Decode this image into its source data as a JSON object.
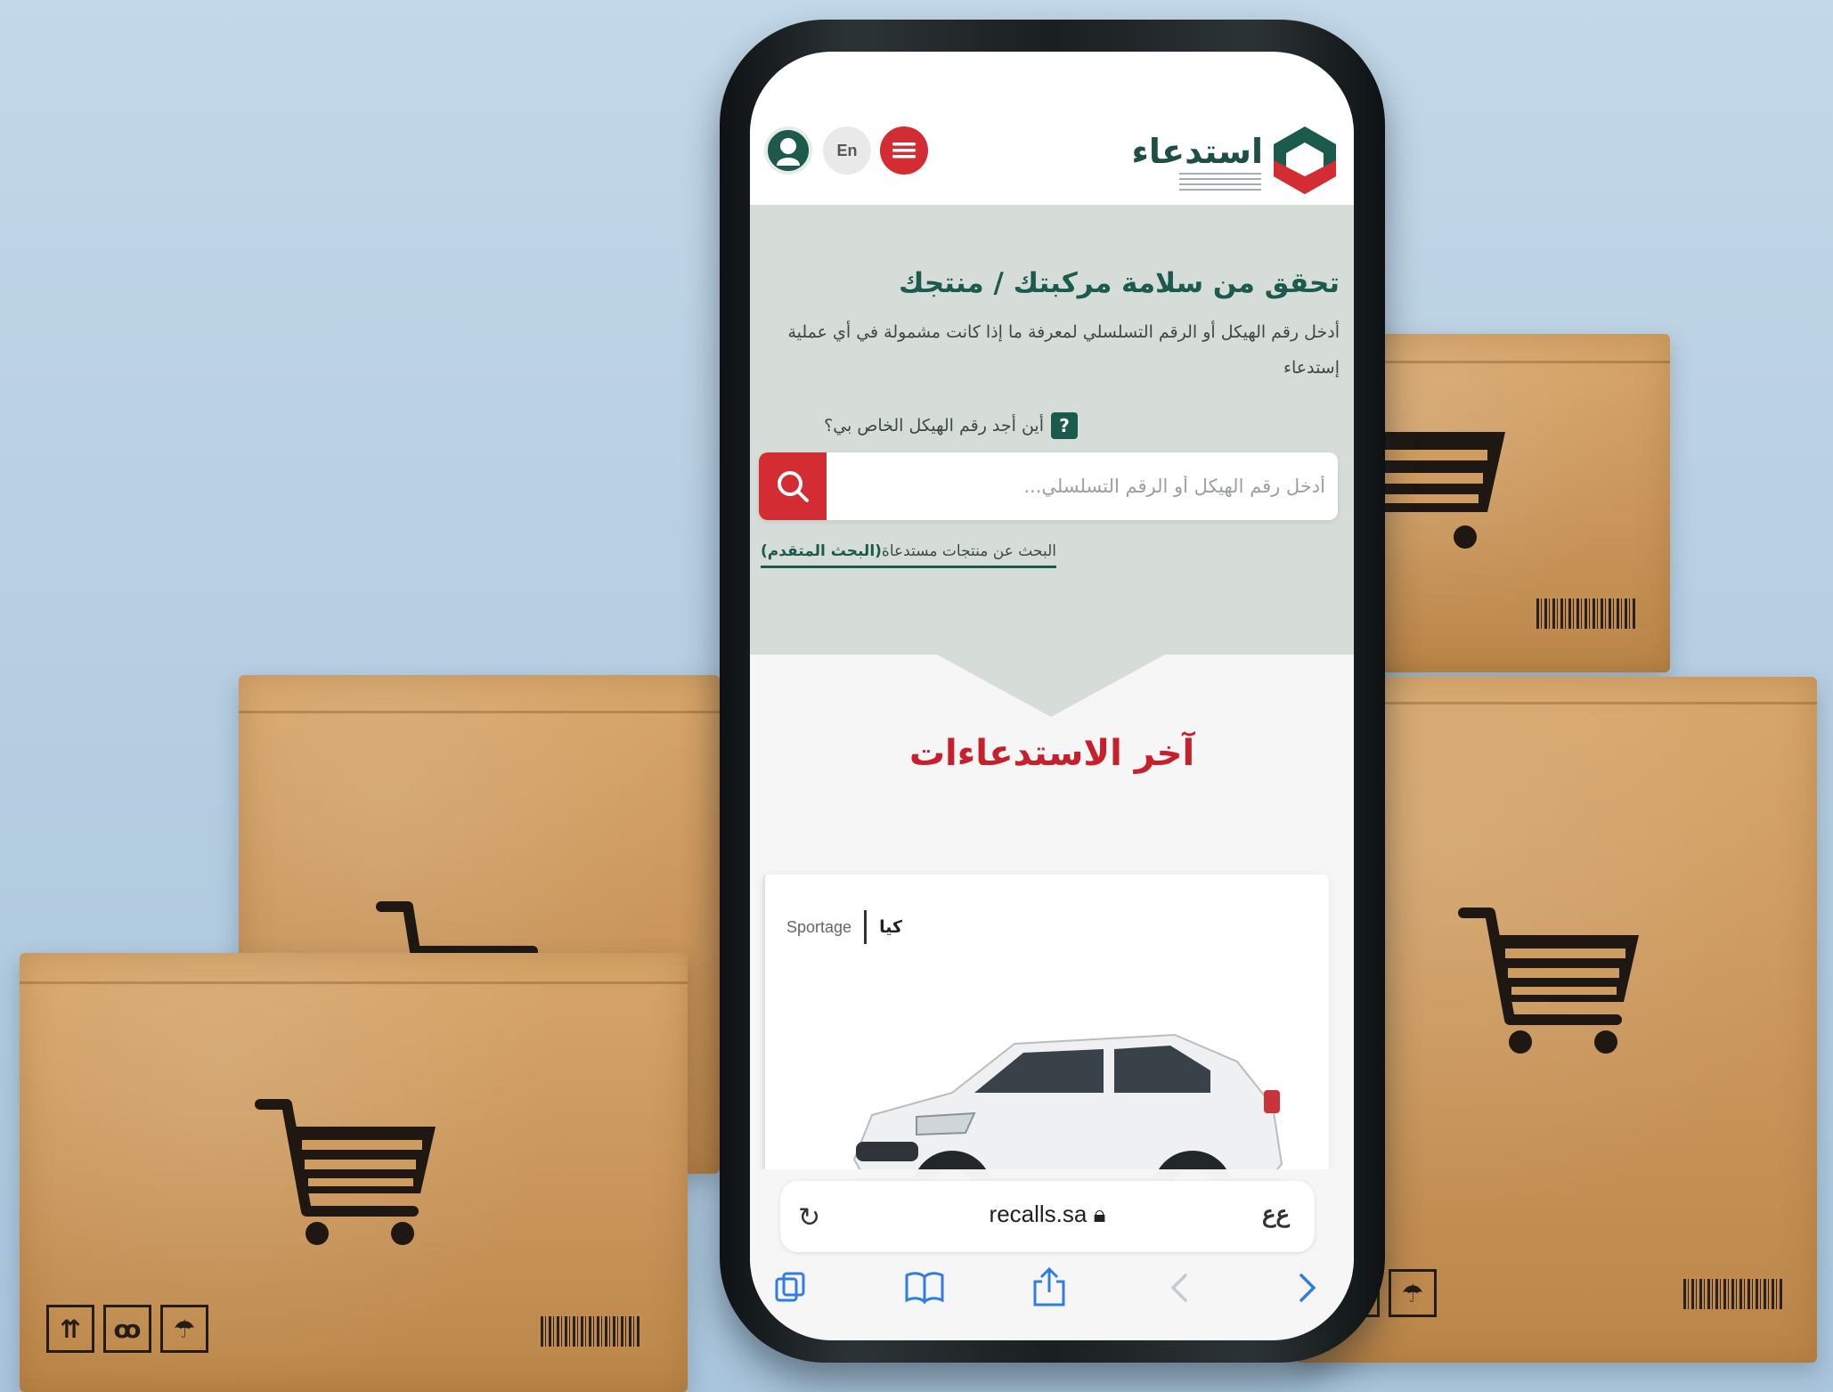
{
  "app": {
    "brand_name": "استدعاء",
    "lang_toggle": "En"
  },
  "hero": {
    "title": "تحقق من سلامة مركبتك / منتجك",
    "description": "أدخل رقم الهيكل أو الرقم التسلسلي لمعرفة ما إذا كانت مشمولة في أي عملية إستدعاء",
    "help_text": "أين أجد رقم الهيكل الخاص بي؟",
    "help_icon": "?"
  },
  "search": {
    "placeholder": "أدخل رقم الهيكل أو الرقم التسلسلي..."
  },
  "advanced_search": {
    "prefix": "البحث عن منتجات مستدعاة",
    "link": "(البحث المتقدم)"
  },
  "latest_recalls": {
    "title": "آخر الاستدعاءات",
    "items": [
      {
        "brand": "كيا",
        "model": "Sportage"
      }
    ]
  },
  "browser": {
    "url": "recalls.sa",
    "text_size_label": "ﻉﻉ",
    "toolbar_icons": [
      "tabs-icon",
      "bookmarks-icon",
      "share-icon",
      "back-icon",
      "forward-icon"
    ]
  },
  "colors": {
    "brand_green": "#1b5b4d",
    "brand_red": "#d42c33",
    "hero_bg": "#d6dcd8"
  }
}
